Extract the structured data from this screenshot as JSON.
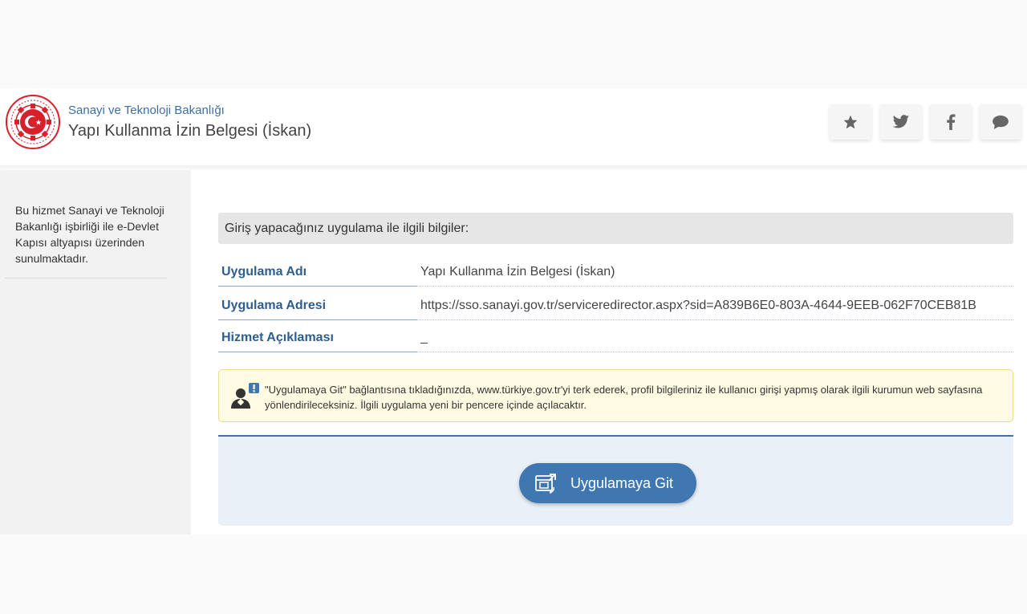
{
  "header": {
    "ministry": "Sanayi ve Teknoloji Bakanlığı",
    "title": "Yapı Kullanma İzin Belgesi (İskan)",
    "icons": [
      "star-icon",
      "twitter-icon",
      "facebook-icon",
      "chat-icon"
    ]
  },
  "sidebar": {
    "text": "Bu hizmet Sanayi ve Teknoloji Bakanlığı işbirliği ile e-Devlet Kapısı altyapısı üzerinden sunulmaktadır."
  },
  "main": {
    "info_header": "Giriş yapacağınız uygulama ile ilgili bilgiler:",
    "rows": [
      {
        "label": "Uygulama Adı",
        "value": "Yapı Kullanma İzin Belgesi (İskan)"
      },
      {
        "label": "Uygulama Adresi",
        "value": "https://sso.sanayi.gov.tr/serviceredirector.aspx?sid=A839B6E0-803A-4644-9EEB-062F70CEB81B"
      },
      {
        "label": "Hizmet Açıklaması",
        "value": "_"
      }
    ],
    "warning": "\"Uygulamaya Git\" bağlantısına tıkladığınızda, www.türkiye.gov.tr'yi terk ederek, profil bilgileriniz ile kullanıcı girişi yapmış olarak ilgili kurumun web sayfasına yönlendirileceksiniz. İlgili uygulama yeni bir pencere içinde açılacaktır.",
    "button_label": "Uygulamaya Git"
  },
  "colors": {
    "accent": "#3f77b0",
    "label_blue": "#2e5e8e",
    "logo_red": "#d6202b",
    "warning_bg": "#fffbe3"
  }
}
